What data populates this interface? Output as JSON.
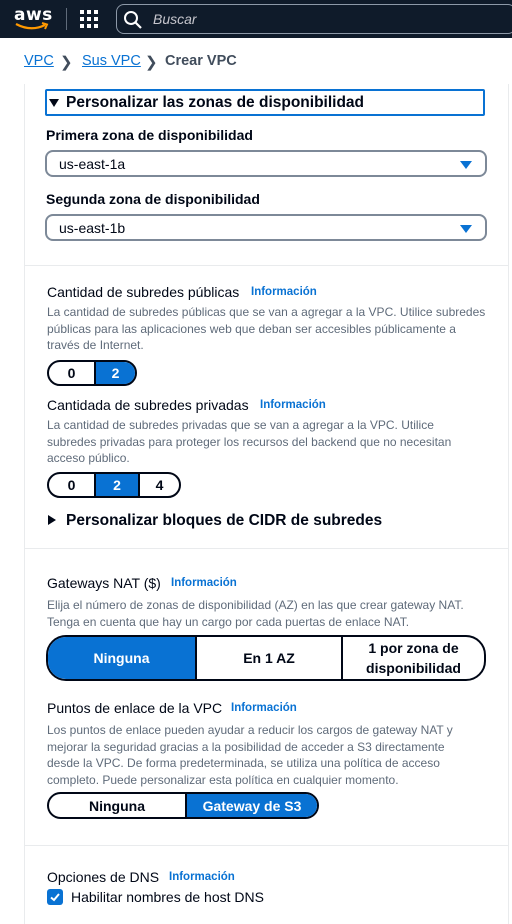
{
  "topbar": {
    "logo": "aws",
    "search_placeholder": "Buscar"
  },
  "breadcrumb": {
    "items": [
      "VPC",
      "Sus VPC"
    ],
    "current": "Crear VPC"
  },
  "az_section": {
    "expander_label": "Personalizar las zonas de disponibilidad",
    "first_label": "Primera zona de disponibilidad",
    "first_value": "us-east-1a",
    "second_label": "Segunda zona de disponibilidad",
    "second_value": "us-east-1b"
  },
  "public_subnets": {
    "label": "Cantidad de subredes públicas",
    "info": "Información",
    "desc_lines": [
      "La cantidad de subredes públicas que se van a agregar a la VPC. Utilice subredes",
      "públicas para las aplicaciones web que deban ser accesibles públicamente a",
      "través de Internet."
    ],
    "options": [
      "0",
      "2"
    ],
    "selected": "2"
  },
  "private_subnets": {
    "label": "Cantidada de subredes privadas",
    "info": "Información",
    "desc_lines": [
      "La cantidad de subredes privadas que se van a agregar a la VPC. Utilice",
      "subredes privadas para proteger los recursos del backend que no necesitan",
      "acceso público."
    ],
    "options": [
      "0",
      "2",
      "4"
    ],
    "selected": "2"
  },
  "cidr_expander": "Personalizar bloques de CIDR de subredes",
  "nat": {
    "label": "Gateways NAT ($)",
    "info": "Información",
    "desc_lines": [
      "Elija el número de zonas de disponibilidad (AZ) en las que crear gateway NAT.",
      "Tenga en cuenta que hay un cargo por cada puertas de enlace NAT."
    ],
    "options": [
      "Ninguna",
      "En 1 AZ",
      "1 por zona de disponibilidad"
    ],
    "selected": "Ninguna"
  },
  "endpoints": {
    "label": "Puntos de enlace de la VPC",
    "info": "Información",
    "desc_lines": [
      "Los puntos de enlace pueden ayudar a reducir los cargos de gateway NAT y",
      "mejorar la seguridad gracias a la posibilidad de acceder a S3 directamente",
      "desde la VPC. De forma predeterminada, se utiliza una política de acceso",
      "completo. Puede personalizar esta política en cualquier momento."
    ],
    "options": [
      "Ninguna",
      "Gateway de S3"
    ],
    "selected": "Gateway de S3"
  },
  "dns": {
    "label": "Opciones de DNS",
    "info": "Información",
    "hostnames_label": "Habilitar nombres de host DNS",
    "hostnames_checked": true
  },
  "colors": {
    "topbar": "#0f1b2a",
    "accent": "#0972d3",
    "text": "#000716",
    "muted": "#5f6b7a"
  }
}
